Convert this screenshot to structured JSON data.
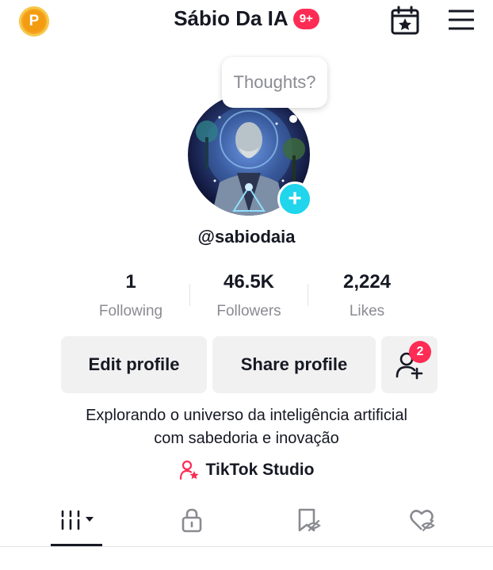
{
  "header": {
    "coin_letter": "P",
    "title": "Sábio Da IA",
    "notification_badge": "9+",
    "calendar_icon": "calendar-star-icon",
    "menu_icon": "hamburger-menu-icon"
  },
  "profile": {
    "bubble_text": "Thoughts?",
    "add_icon": "+",
    "username": "@sabiodaia"
  },
  "stats": [
    {
      "value": "1",
      "label": "Following"
    },
    {
      "value": "46.5K",
      "label": "Followers"
    },
    {
      "value": "2,224",
      "label": "Likes"
    }
  ],
  "actions": {
    "edit_profile": "Edit profile",
    "share_profile": "Share profile",
    "add_friends_badge": "2"
  },
  "bio": {
    "line1": "Explorando o universo da inteligência artificial",
    "line2": "com sabedoria e inovação"
  },
  "studio": {
    "label": "TikTok Studio",
    "icon": "person-star-icon"
  },
  "tabs": [
    {
      "icon": "videos-grid-icon",
      "active": true
    },
    {
      "icon": "lock-icon",
      "active": false
    },
    {
      "icon": "bookmark-icon",
      "active": false
    },
    {
      "icon": "liked-heart-icon",
      "active": false
    }
  ],
  "colors": {
    "accent_red": "#fe2c55",
    "accent_cyan": "#20d5ec",
    "coin_gold": "#f5a623",
    "button_gray": "#f1f1f2",
    "text_secondary": "#8a8b91"
  }
}
